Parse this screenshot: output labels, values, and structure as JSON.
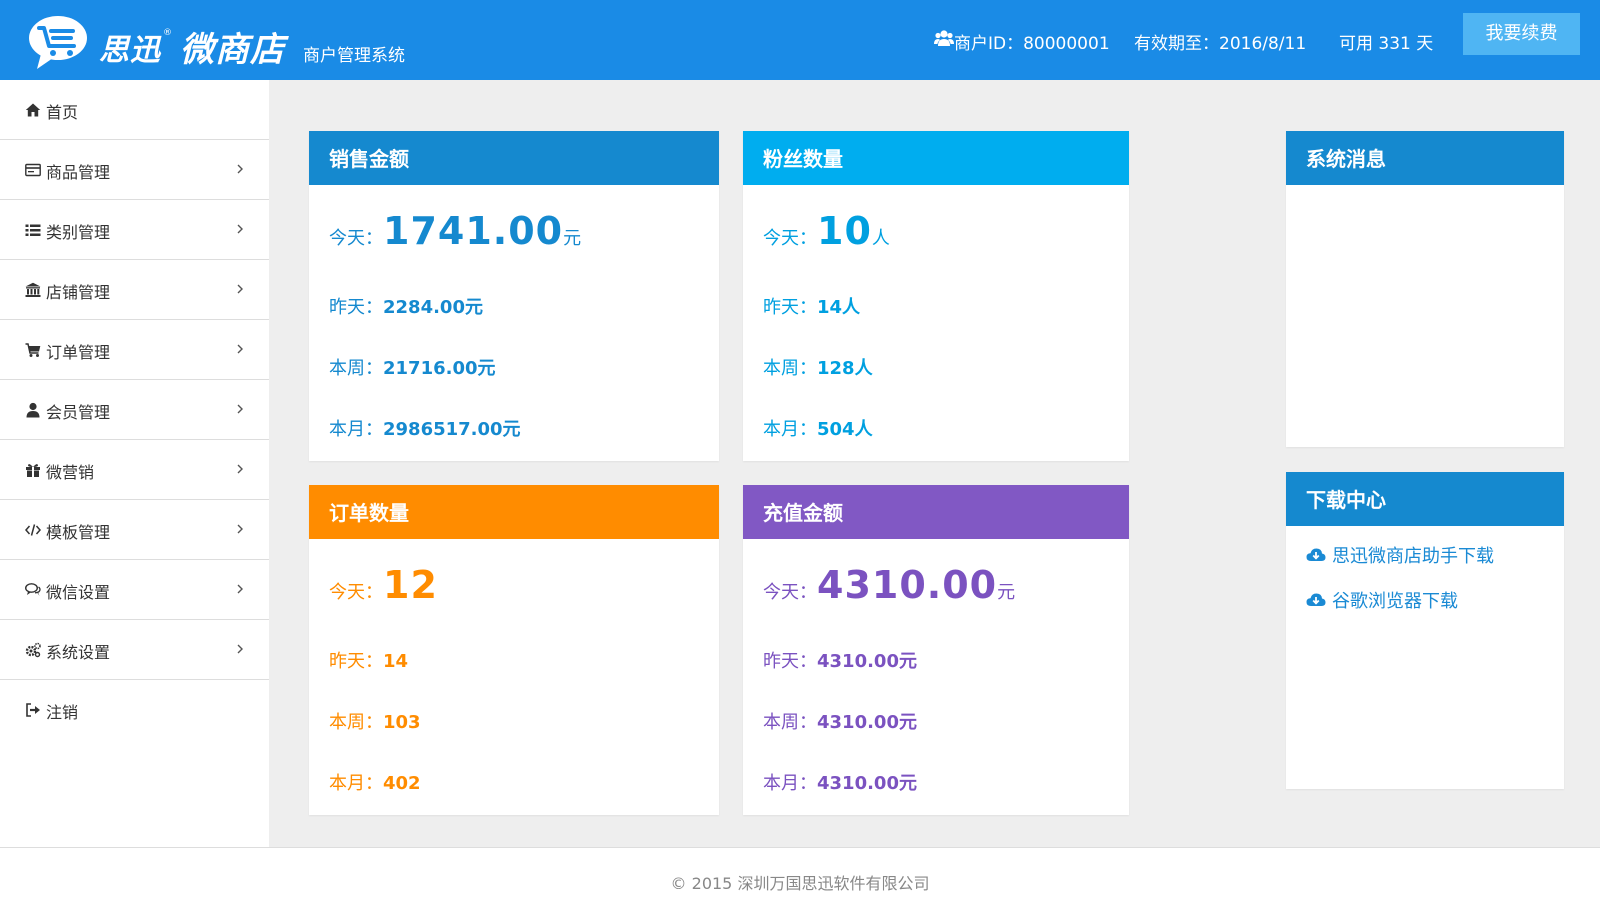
{
  "header": {
    "brand_part1": "思迅",
    "brand_reg": "®",
    "brand_part2": "微商店",
    "subtitle": "商户管理系统",
    "merchant_id": "商户ID：80000001",
    "valid_until": "有效期至：2016/8/11",
    "days_available": "可用 331 天",
    "renew_label": "我要续费",
    "color": "#1a8be6"
  },
  "sidebar": {
    "items": [
      {
        "label": "首页",
        "icon": "home-icon"
      },
      {
        "label": "商品管理",
        "icon": "product-card-icon"
      },
      {
        "label": "类别管理",
        "icon": "list-icon"
      },
      {
        "label": "店铺管理",
        "icon": "bank-icon"
      },
      {
        "label": "订单管理",
        "icon": "cart-icon"
      },
      {
        "label": "会员管理",
        "icon": "user-icon"
      },
      {
        "label": "微营销",
        "icon": "gift-icon"
      },
      {
        "label": "模板管理",
        "icon": "code-icon"
      },
      {
        "label": "微信设置",
        "icon": "chat-icon"
      },
      {
        "label": "系统设置",
        "icon": "gears-icon"
      },
      {
        "label": "注销",
        "icon": "logout-icon"
      }
    ]
  },
  "cards": {
    "sales": {
      "title": "销售金额",
      "color": "#1589cf",
      "today_label": "今天：",
      "today_value": "1741.00",
      "today_unit": "元",
      "yesterday_label": "昨天：",
      "yesterday_value": "2284.00元",
      "week_label": "本周：",
      "week_value": "21716.00元",
      "month_label": "本月：",
      "month_value": "2986517.00元"
    },
    "fans": {
      "title": "粉丝数量",
      "color": "#00adef",
      "today_label": "今天：",
      "today_value": "10",
      "today_unit": "人",
      "yesterday_label": "昨天：",
      "yesterday_value": "14人",
      "week_label": "本周：",
      "week_value": "128人",
      "month_label": "本月：",
      "month_value": "504人"
    },
    "orders": {
      "title": "订单数量",
      "color": "#ff8c00",
      "today_label": "今天：",
      "today_value": "12",
      "today_unit": "",
      "yesterday_label": "昨天：",
      "yesterday_value": "14",
      "week_label": "本周：",
      "week_value": "103",
      "month_label": "本月：",
      "month_value": "402"
    },
    "recharge": {
      "title": "充值金额",
      "color": "#8158c4",
      "today_label": "今天：",
      "today_value": "4310.00",
      "today_unit": "元",
      "yesterday_label": "昨天：",
      "yesterday_value": "4310.00元",
      "week_label": "本周：",
      "week_value": "4310.00元",
      "month_label": "本月：",
      "month_value": "4310.00元"
    }
  },
  "messages": {
    "title": "系统消息",
    "color": "#1589cf"
  },
  "downloads": {
    "title": "下载中心",
    "color": "#1589cf",
    "links": [
      {
        "label": "思迅微商店助手下载",
        "icon": "cloud-download-icon"
      },
      {
        "label": "谷歌浏览器下载",
        "icon": "cloud-download-icon"
      }
    ]
  },
  "footer": {
    "copyright": "© 2015 深圳万国思迅软件有限公司"
  }
}
